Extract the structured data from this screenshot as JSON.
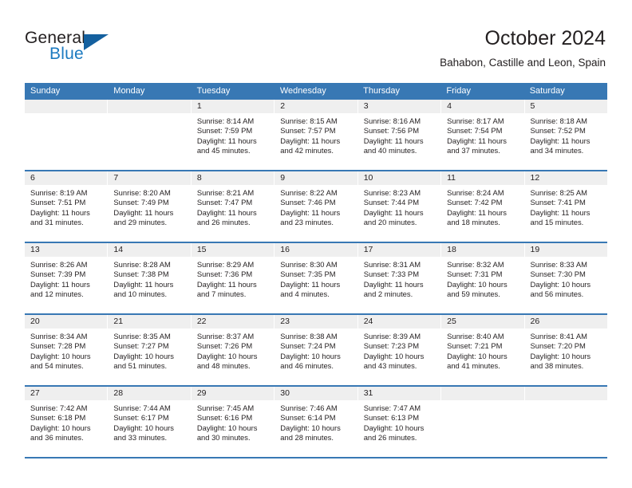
{
  "brand": {
    "name_part1": "General",
    "name_part2": "Blue",
    "triangle_color": "#14609f",
    "blue_text_color": "#1c7ac0"
  },
  "header": {
    "title": "October 2024",
    "subtitle": "Bahabon, Castille and Leon, Spain"
  },
  "theme": {
    "header_row_bg": "#3878b4",
    "daynum_bg": "#efefef",
    "week_separator": "#3878b4",
    "text": "#231f20"
  },
  "weekdays": [
    "Sunday",
    "Monday",
    "Tuesday",
    "Wednesday",
    "Thursday",
    "Friday",
    "Saturday"
  ],
  "weeks": [
    [
      {
        "day": "",
        "sunrise": "",
        "sunset": "",
        "daylight": "",
        "empty": true
      },
      {
        "day": "",
        "sunrise": "",
        "sunset": "",
        "daylight": "",
        "empty": true
      },
      {
        "day": "1",
        "sunrise": "Sunrise: 8:14 AM",
        "sunset": "Sunset: 7:59 PM",
        "daylight": "Daylight: 11 hours and 45 minutes."
      },
      {
        "day": "2",
        "sunrise": "Sunrise: 8:15 AM",
        "sunset": "Sunset: 7:57 PM",
        "daylight": "Daylight: 11 hours and 42 minutes."
      },
      {
        "day": "3",
        "sunrise": "Sunrise: 8:16 AM",
        "sunset": "Sunset: 7:56 PM",
        "daylight": "Daylight: 11 hours and 40 minutes."
      },
      {
        "day": "4",
        "sunrise": "Sunrise: 8:17 AM",
        "sunset": "Sunset: 7:54 PM",
        "daylight": "Daylight: 11 hours and 37 minutes."
      },
      {
        "day": "5",
        "sunrise": "Sunrise: 8:18 AM",
        "sunset": "Sunset: 7:52 PM",
        "daylight": "Daylight: 11 hours and 34 minutes."
      }
    ],
    [
      {
        "day": "6",
        "sunrise": "Sunrise: 8:19 AM",
        "sunset": "Sunset: 7:51 PM",
        "daylight": "Daylight: 11 hours and 31 minutes."
      },
      {
        "day": "7",
        "sunrise": "Sunrise: 8:20 AM",
        "sunset": "Sunset: 7:49 PM",
        "daylight": "Daylight: 11 hours and 29 minutes."
      },
      {
        "day": "8",
        "sunrise": "Sunrise: 8:21 AM",
        "sunset": "Sunset: 7:47 PM",
        "daylight": "Daylight: 11 hours and 26 minutes."
      },
      {
        "day": "9",
        "sunrise": "Sunrise: 8:22 AM",
        "sunset": "Sunset: 7:46 PM",
        "daylight": "Daylight: 11 hours and 23 minutes."
      },
      {
        "day": "10",
        "sunrise": "Sunrise: 8:23 AM",
        "sunset": "Sunset: 7:44 PM",
        "daylight": "Daylight: 11 hours and 20 minutes."
      },
      {
        "day": "11",
        "sunrise": "Sunrise: 8:24 AM",
        "sunset": "Sunset: 7:42 PM",
        "daylight": "Daylight: 11 hours and 18 minutes."
      },
      {
        "day": "12",
        "sunrise": "Sunrise: 8:25 AM",
        "sunset": "Sunset: 7:41 PM",
        "daylight": "Daylight: 11 hours and 15 minutes."
      }
    ],
    [
      {
        "day": "13",
        "sunrise": "Sunrise: 8:26 AM",
        "sunset": "Sunset: 7:39 PM",
        "daylight": "Daylight: 11 hours and 12 minutes."
      },
      {
        "day": "14",
        "sunrise": "Sunrise: 8:28 AM",
        "sunset": "Sunset: 7:38 PM",
        "daylight": "Daylight: 11 hours and 10 minutes."
      },
      {
        "day": "15",
        "sunrise": "Sunrise: 8:29 AM",
        "sunset": "Sunset: 7:36 PM",
        "daylight": "Daylight: 11 hours and 7 minutes."
      },
      {
        "day": "16",
        "sunrise": "Sunrise: 8:30 AM",
        "sunset": "Sunset: 7:35 PM",
        "daylight": "Daylight: 11 hours and 4 minutes."
      },
      {
        "day": "17",
        "sunrise": "Sunrise: 8:31 AM",
        "sunset": "Sunset: 7:33 PM",
        "daylight": "Daylight: 11 hours and 2 minutes."
      },
      {
        "day": "18",
        "sunrise": "Sunrise: 8:32 AM",
        "sunset": "Sunset: 7:31 PM",
        "daylight": "Daylight: 10 hours and 59 minutes."
      },
      {
        "day": "19",
        "sunrise": "Sunrise: 8:33 AM",
        "sunset": "Sunset: 7:30 PM",
        "daylight": "Daylight: 10 hours and 56 minutes."
      }
    ],
    [
      {
        "day": "20",
        "sunrise": "Sunrise: 8:34 AM",
        "sunset": "Sunset: 7:28 PM",
        "daylight": "Daylight: 10 hours and 54 minutes."
      },
      {
        "day": "21",
        "sunrise": "Sunrise: 8:35 AM",
        "sunset": "Sunset: 7:27 PM",
        "daylight": "Daylight: 10 hours and 51 minutes."
      },
      {
        "day": "22",
        "sunrise": "Sunrise: 8:37 AM",
        "sunset": "Sunset: 7:26 PM",
        "daylight": "Daylight: 10 hours and 48 minutes."
      },
      {
        "day": "23",
        "sunrise": "Sunrise: 8:38 AM",
        "sunset": "Sunset: 7:24 PM",
        "daylight": "Daylight: 10 hours and 46 minutes."
      },
      {
        "day": "24",
        "sunrise": "Sunrise: 8:39 AM",
        "sunset": "Sunset: 7:23 PM",
        "daylight": "Daylight: 10 hours and 43 minutes."
      },
      {
        "day": "25",
        "sunrise": "Sunrise: 8:40 AM",
        "sunset": "Sunset: 7:21 PM",
        "daylight": "Daylight: 10 hours and 41 minutes."
      },
      {
        "day": "26",
        "sunrise": "Sunrise: 8:41 AM",
        "sunset": "Sunset: 7:20 PM",
        "daylight": "Daylight: 10 hours and 38 minutes."
      }
    ],
    [
      {
        "day": "27",
        "sunrise": "Sunrise: 7:42 AM",
        "sunset": "Sunset: 6:18 PM",
        "daylight": "Daylight: 10 hours and 36 minutes."
      },
      {
        "day": "28",
        "sunrise": "Sunrise: 7:44 AM",
        "sunset": "Sunset: 6:17 PM",
        "daylight": "Daylight: 10 hours and 33 minutes."
      },
      {
        "day": "29",
        "sunrise": "Sunrise: 7:45 AM",
        "sunset": "Sunset: 6:16 PM",
        "daylight": "Daylight: 10 hours and 30 minutes."
      },
      {
        "day": "30",
        "sunrise": "Sunrise: 7:46 AM",
        "sunset": "Sunset: 6:14 PM",
        "daylight": "Daylight: 10 hours and 28 minutes."
      },
      {
        "day": "31",
        "sunrise": "Sunrise: 7:47 AM",
        "sunset": "Sunset: 6:13 PM",
        "daylight": "Daylight: 10 hours and 26 minutes."
      },
      {
        "day": "",
        "sunrise": "",
        "sunset": "",
        "daylight": "",
        "empty": true
      },
      {
        "day": "",
        "sunrise": "",
        "sunset": "",
        "daylight": "",
        "empty": true
      }
    ]
  ]
}
